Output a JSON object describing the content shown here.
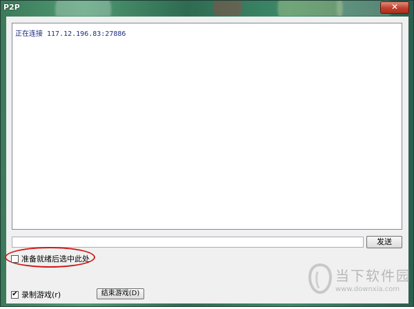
{
  "window": {
    "title": "P2P",
    "close_label": "✕"
  },
  "log": {
    "lines": [
      "正在连接 117.12.196.83:27886"
    ]
  },
  "chat": {
    "input_value": "",
    "send_label": "发送"
  },
  "options": {
    "ready_label": "准备就绪后选中此处",
    "ready_checked": false,
    "record_label": "录制游戏(r)",
    "record_checked": true,
    "end_label": "结束游戏(D)"
  },
  "watermark": {
    "brand": "当下软件园",
    "url": "www.downxia.com"
  },
  "colors": {
    "log_text": "#1a2a80",
    "annotation": "#d01818",
    "title_text": "#ffffff"
  }
}
